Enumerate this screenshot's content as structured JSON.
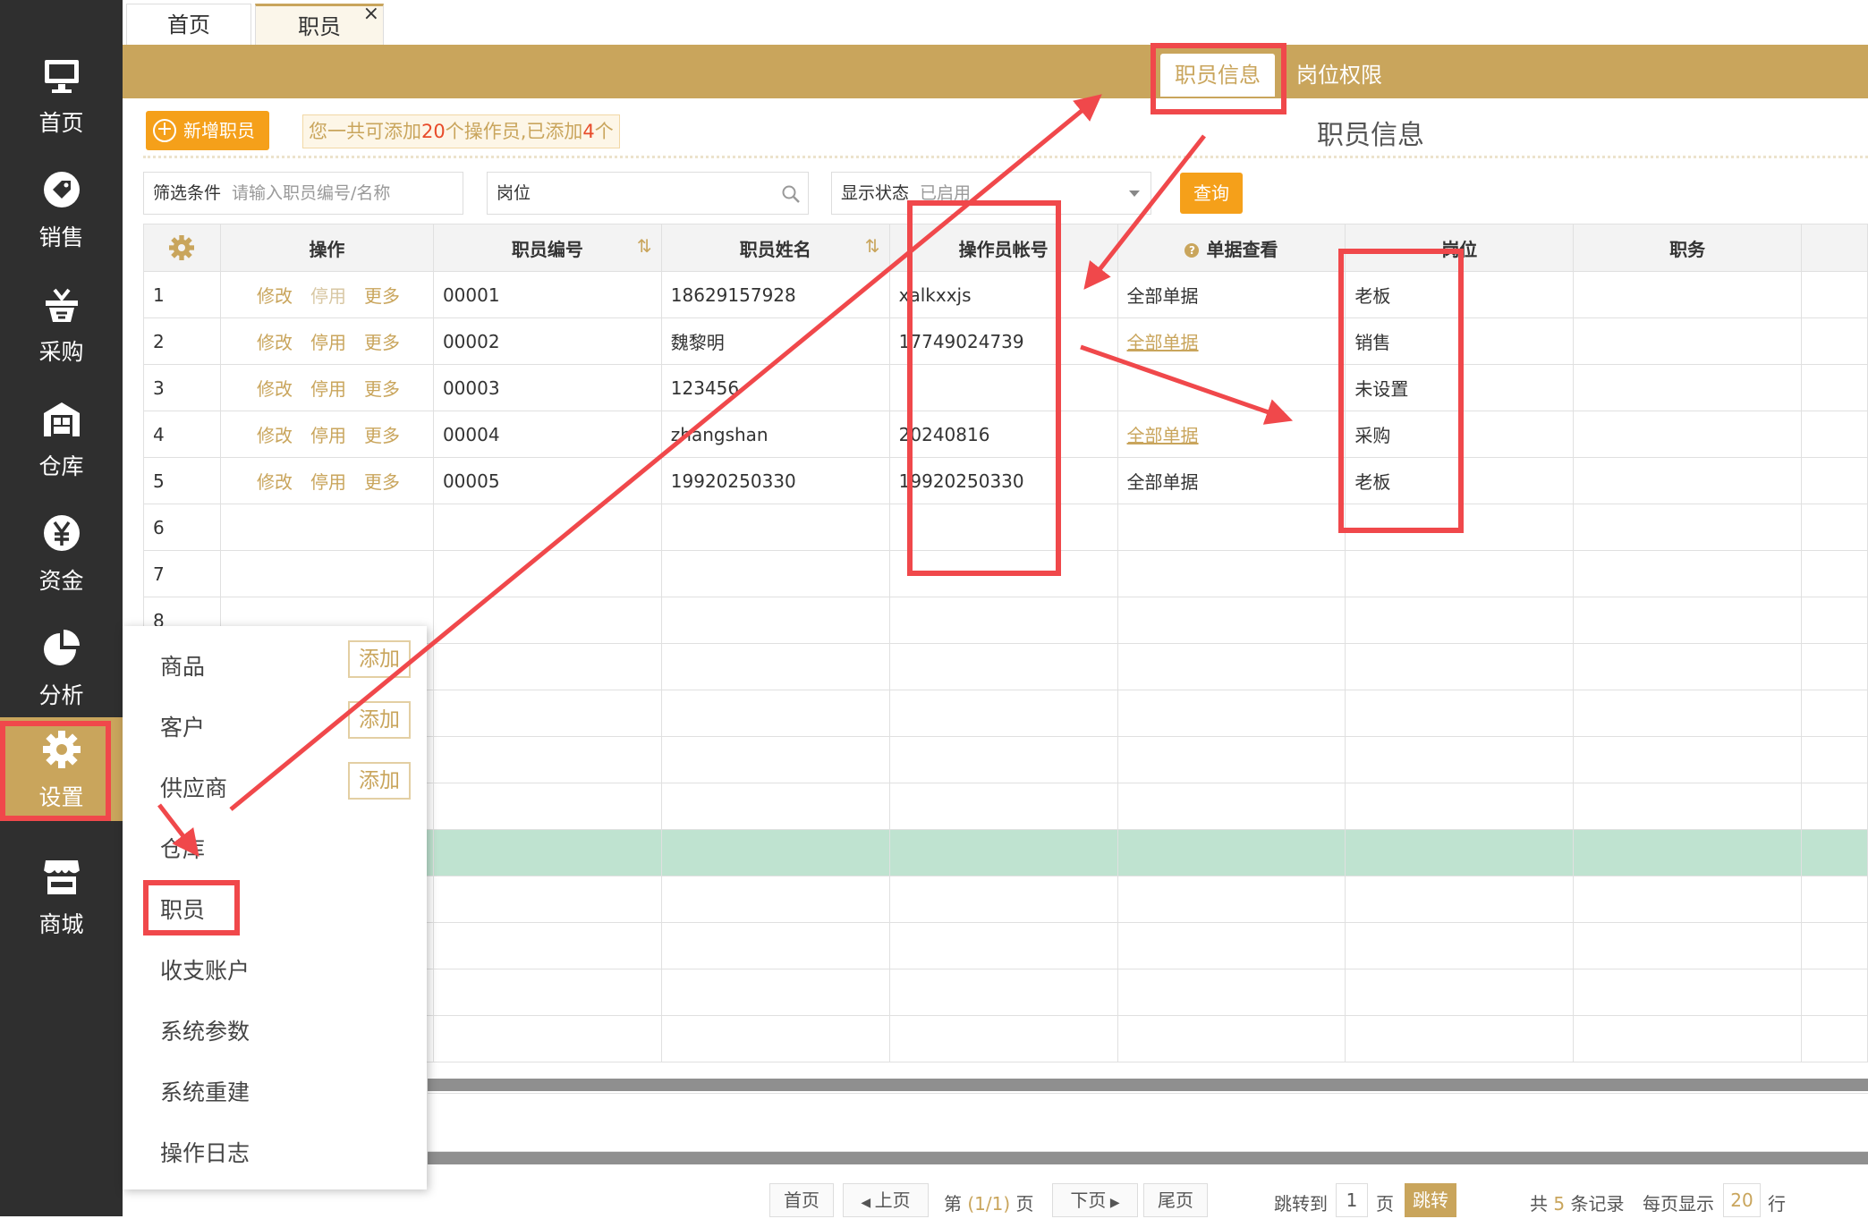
{
  "left_nav": {
    "items": [
      {
        "label": "首页",
        "icon": "monitor-icon"
      },
      {
        "label": "销售",
        "icon": "tag-icon"
      },
      {
        "label": "采购",
        "icon": "basket-icon"
      },
      {
        "label": "仓库",
        "icon": "warehouse-icon"
      },
      {
        "label": "资金",
        "icon": "yuan-icon"
      },
      {
        "label": "分析",
        "icon": "pie-icon"
      },
      {
        "label": "设置",
        "icon": "gear-icon"
      },
      {
        "label": "商城",
        "icon": "store-icon"
      }
    ],
    "active": "设置"
  },
  "top_tabs": [
    {
      "label": "首页",
      "closable": false
    },
    {
      "label": "职员",
      "closable": true,
      "close_glyph": "×"
    }
  ],
  "sub_tabs": [
    {
      "label": "职员信息",
      "active": true
    },
    {
      "label": "岗位权限",
      "active": false
    }
  ],
  "toolbar": {
    "add_button": "新增职员",
    "note_prefix": "您一共可添加",
    "note_max": "20",
    "note_middle": "个操作员,已添加",
    "note_count": "4",
    "note_suffix": "个"
  },
  "page_title": "职员信息",
  "filters": {
    "condition_label": "筛选条件",
    "condition_placeholder": "请输入职员编号/名称",
    "position_placeholder": "岗位",
    "status_label": "显示状态",
    "status_value": "已启用",
    "query_button": "查询"
  },
  "table": {
    "columns": [
      "操作",
      "职员编号",
      "职员姓名",
      "操作员帐号",
      "单据查看",
      "岗位",
      "职务"
    ],
    "sort_glyph": "⇅",
    "action_labels": {
      "edit": "修改",
      "disable": "停用",
      "more": "更多"
    },
    "rows": [
      {
        "no": "1",
        "code": "00001",
        "name": "18629157928",
        "account": "xalkxxjs",
        "docs": "全部单据",
        "docs_link": false,
        "position": "老板",
        "title": ""
      },
      {
        "no": "2",
        "code": "00002",
        "name": "魏黎明",
        "account": "17749024739",
        "docs": "全部单据",
        "docs_link": true,
        "position": "销售",
        "title": ""
      },
      {
        "no": "3",
        "code": "00003",
        "name": "123456",
        "account": "",
        "docs": "",
        "docs_link": false,
        "position": "未设置",
        "title": ""
      },
      {
        "no": "4",
        "code": "00004",
        "name": "zhangshan",
        "account": "20240816",
        "docs": "全部单据",
        "docs_link": true,
        "position": "采购",
        "title": ""
      },
      {
        "no": "5",
        "code": "00005",
        "name": "19920250330",
        "account": "19920250330",
        "docs": "全部单据",
        "docs_link": false,
        "position": "老板",
        "title": ""
      }
    ],
    "empty_row_numbers": [
      "6",
      "7",
      "8"
    ]
  },
  "settings_menu": {
    "items": [
      {
        "label": "商品",
        "add": "添加"
      },
      {
        "label": "客户",
        "add": "添加"
      },
      {
        "label": "供应商",
        "add": "添加"
      },
      {
        "label": "仓库",
        "add": ""
      },
      {
        "label": "职员",
        "add": ""
      },
      {
        "label": "收支账户",
        "add": ""
      },
      {
        "label": "系统参数",
        "add": ""
      },
      {
        "label": "系统重建",
        "add": ""
      },
      {
        "label": "操作日志",
        "add": ""
      }
    ]
  },
  "pager": {
    "first": "首页",
    "prev": "上页",
    "page_prefix": "第",
    "page_info": "(1/1)",
    "page_suffix": "页",
    "next": "下页",
    "last": "尾页",
    "jump_label": "跳转到",
    "jump_value": "1",
    "jump_unit": "页",
    "jump_button": "跳转",
    "total_prefix": "共",
    "total_count": "5",
    "total_suffix": "条记录",
    "per_page_label": "每页显示",
    "per_page_value": "20",
    "per_page_unit": "行"
  },
  "colors": {
    "brand_gold": "#c9a55c",
    "nav_dark": "#2f2f2f",
    "orange": "#f5a01a",
    "annotation_red": "#f0484b",
    "highlight_row": "#bfe3d0"
  }
}
